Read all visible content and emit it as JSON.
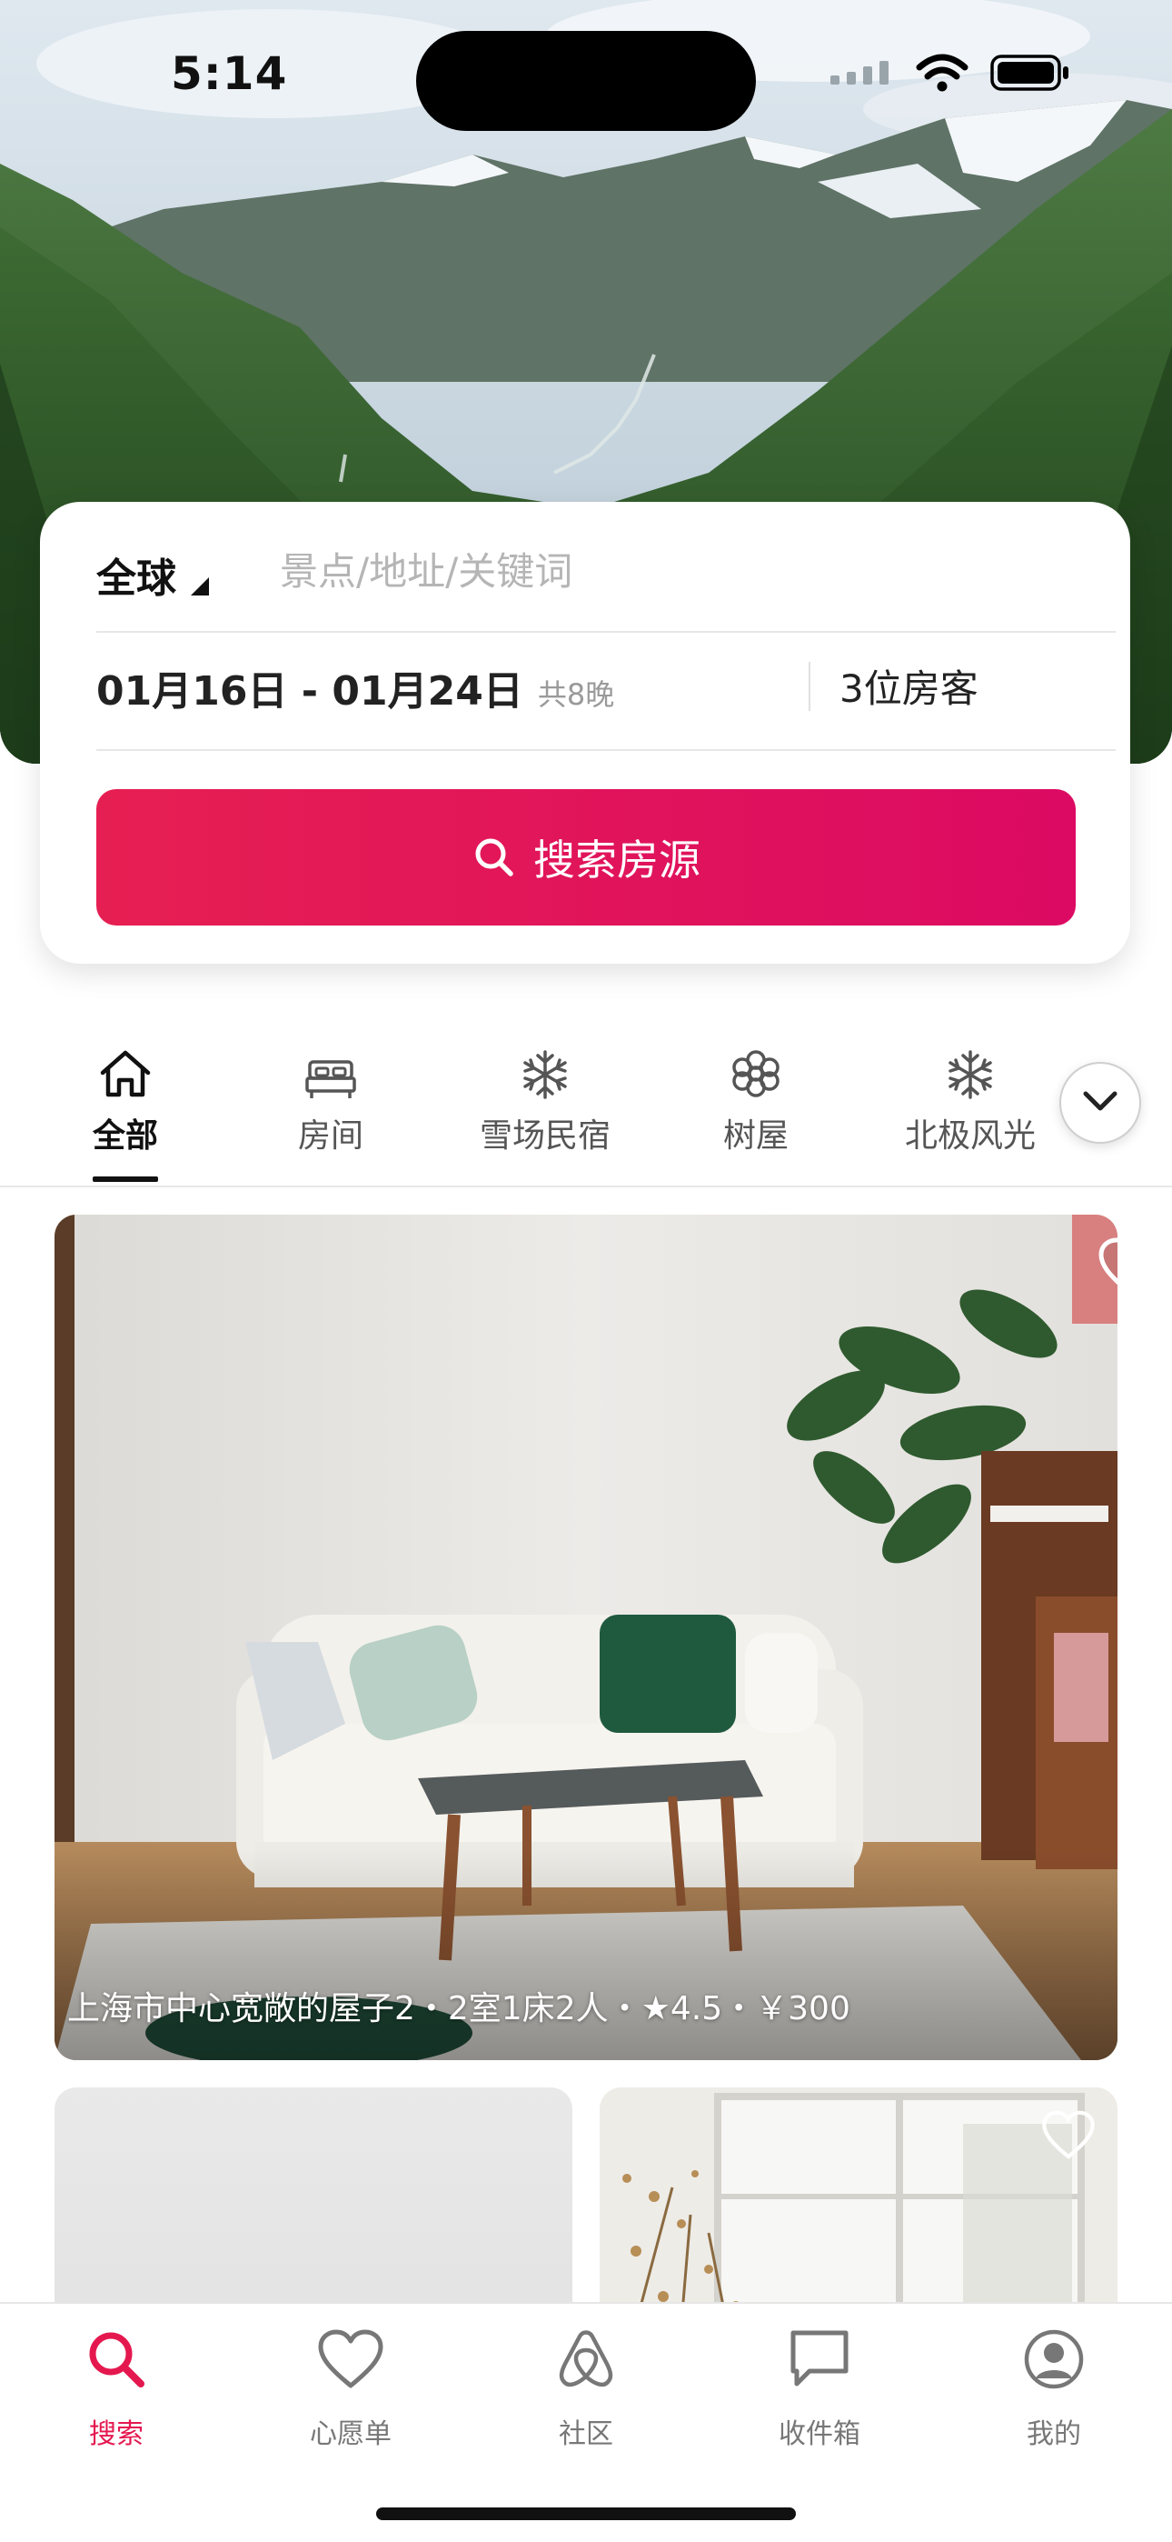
{
  "status_bar": {
    "time": "5:14"
  },
  "search": {
    "region": "全球",
    "keyword_placeholder": "景点/地址/关键词",
    "dates": "01月16日 - 01月24日",
    "nights": "共8晚",
    "guests": "3位房客",
    "button_label": "搜索房源"
  },
  "categories": [
    {
      "label": "全部",
      "icon": "home-icon",
      "active": true
    },
    {
      "label": "房间",
      "icon": "bed-icon",
      "active": false
    },
    {
      "label": "雪场民宿",
      "icon": "snowflake-icon",
      "active": false
    },
    {
      "label": "树屋",
      "icon": "flower-icon",
      "active": false
    },
    {
      "label": "北极风光",
      "icon": "snowflake-icon",
      "active": false
    }
  ],
  "listings": [
    {
      "caption": "上海市中心宽敞的屋子2・2室1床2人・★4.5・￥300",
      "favorite": false
    }
  ],
  "bottom_nav": [
    {
      "label": "搜索",
      "icon": "search-icon",
      "active": true
    },
    {
      "label": "心愿单",
      "icon": "heart-icon",
      "active": false
    },
    {
      "label": "社区",
      "icon": "airbnb-logo-icon",
      "active": false
    },
    {
      "label": "收件箱",
      "icon": "message-icon",
      "active": false
    },
    {
      "label": "我的",
      "icon": "profile-icon",
      "active": false
    }
  ],
  "colors": {
    "accent": "#e4184f",
    "button_gradient_start": "#e61f52",
    "button_gradient_end": "#dc0a63"
  }
}
